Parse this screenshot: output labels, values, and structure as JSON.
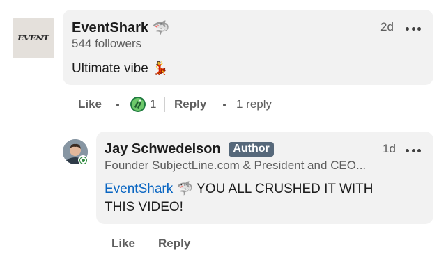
{
  "comment": {
    "author_name": "EventShark",
    "author_emoji": "🦈",
    "followers": "544 followers",
    "time": "2d",
    "text": "Ultimate vibe",
    "text_emoji": "💃",
    "logo_text": "EVENT",
    "actions": {
      "like": "Like",
      "reaction_count": "1",
      "reply": "Reply",
      "replies": "1 reply"
    }
  },
  "reply": {
    "author_name": "Jay Schwedelson",
    "badge": "Author",
    "headline": "Founder SubjectLine.com & President and CEO...",
    "time": "1d",
    "mention": "EventShark",
    "mention_emoji": "🦈",
    "text_line1": "YOU ALL CRUSHED IT WITH",
    "text_line2": "THIS VIDEO!",
    "actions": {
      "like": "Like",
      "reply": "Reply"
    }
  },
  "colors": {
    "bubble": "#f2f2f2",
    "link": "#0a66c2",
    "badge": "#56687a",
    "online": "#2e8a3e",
    "muted_text": "#5e5e5e"
  }
}
